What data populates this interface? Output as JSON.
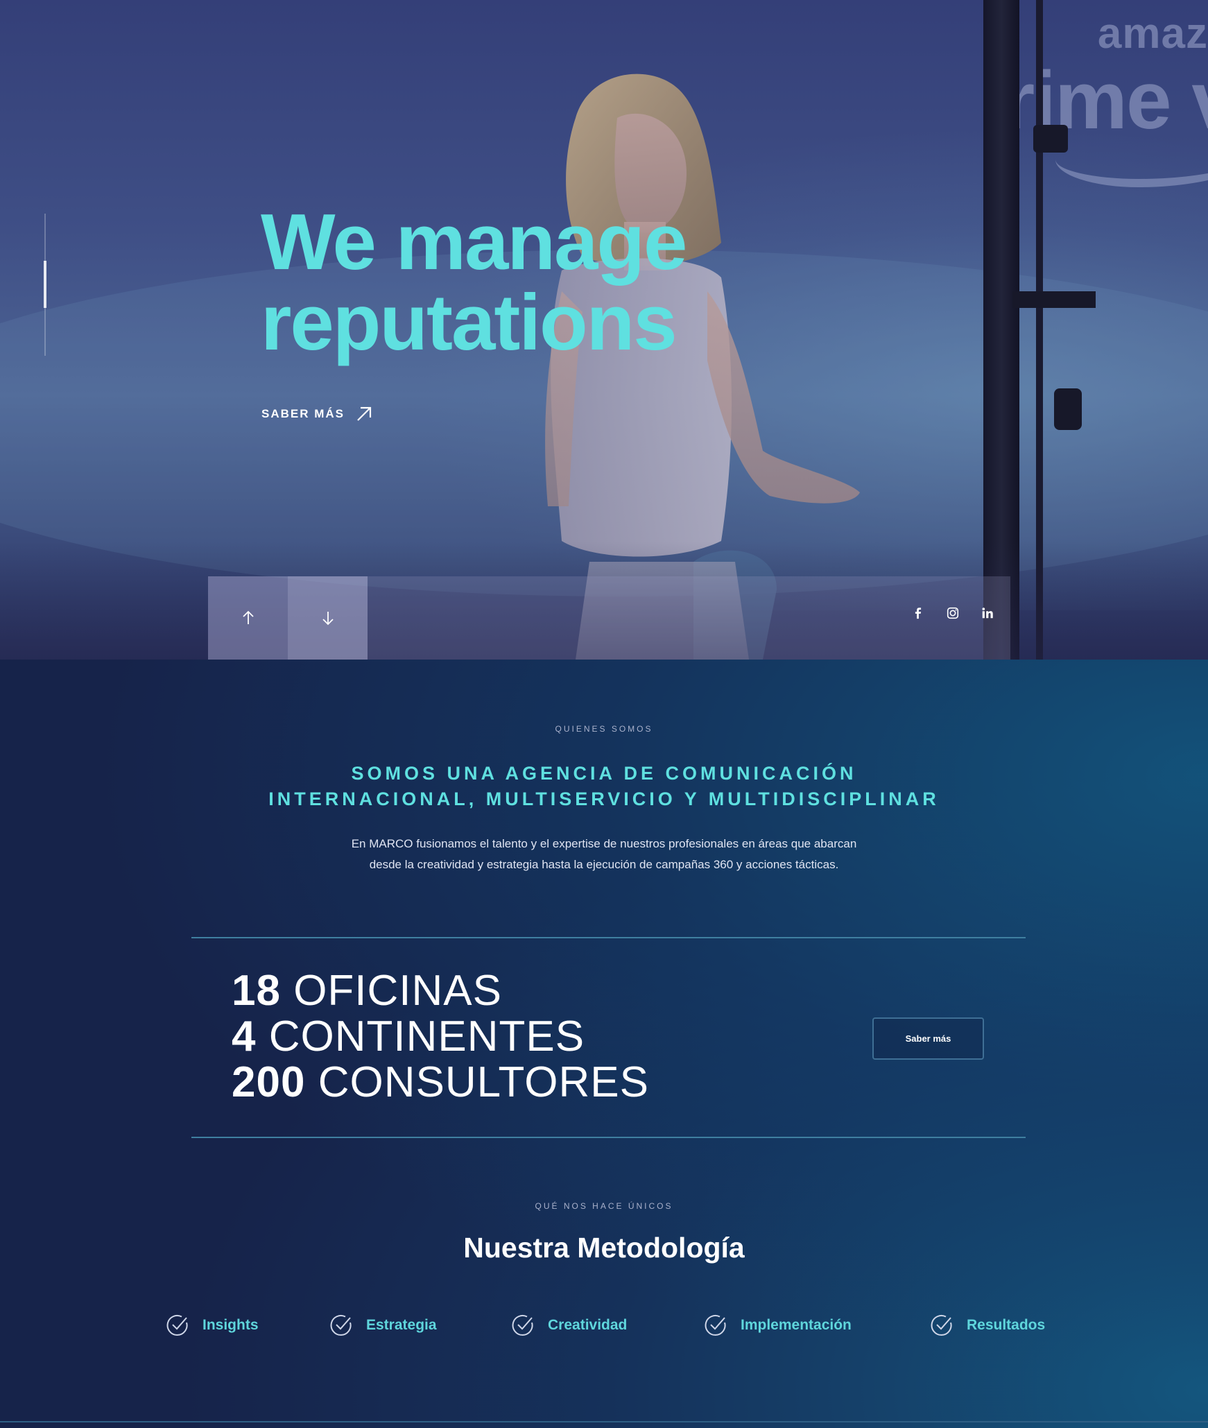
{
  "hero": {
    "backdrop_text_top": "amaz",
    "backdrop_text_main": "rime v",
    "title_line1": "We manage",
    "title_line2": "reputations",
    "cta_label": "SABER MÁS",
    "prev_icon": "arrow-up-icon",
    "next_icon": "arrow-down-icon",
    "socials": [
      {
        "name": "facebook-icon",
        "glyph": "f"
      },
      {
        "name": "instagram-icon",
        "glyph": ""
      },
      {
        "name": "linkedin-icon",
        "glyph": "in"
      }
    ]
  },
  "about": {
    "eyebrow": "QUIENES SOMOS",
    "heading_line1": "SOMOS UNA AGENCIA DE COMUNICACIÓN",
    "heading_line2": "INTERNACIONAL, MULTISERVICIO Y MULTIDISCIPLINAR",
    "body_line1": "En MARCO fusionamos el talento y el expertise de nuestros profesionales en áreas que abarcan",
    "body_line2": "desde la creatividad y estrategia hasta la ejecución de campañas 360 y acciones tácticas."
  },
  "stats": {
    "items": [
      {
        "number": "18",
        "label": "OFICINAS"
      },
      {
        "number": "4",
        "label": "CONTINENTES"
      },
      {
        "number": "200",
        "label": "CONSULTORES"
      }
    ],
    "button_label": "Saber más"
  },
  "methodology": {
    "eyebrow": "QUÉ NOS HACE ÚNICOS",
    "title": "Nuestra Metodología",
    "items": [
      {
        "label": "Insights",
        "icon": "check-circle-icon"
      },
      {
        "label": "Estrategia",
        "icon": "check-circle-icon"
      },
      {
        "label": "Creatividad",
        "icon": "check-circle-icon"
      },
      {
        "label": "Implementación",
        "icon": "check-circle-icon"
      },
      {
        "label": "Resultados",
        "icon": "check-circle-icon"
      }
    ]
  },
  "colors": {
    "accent": "#5fe0e0",
    "navy": "#16234a",
    "rule": "#3f7fa0"
  }
}
